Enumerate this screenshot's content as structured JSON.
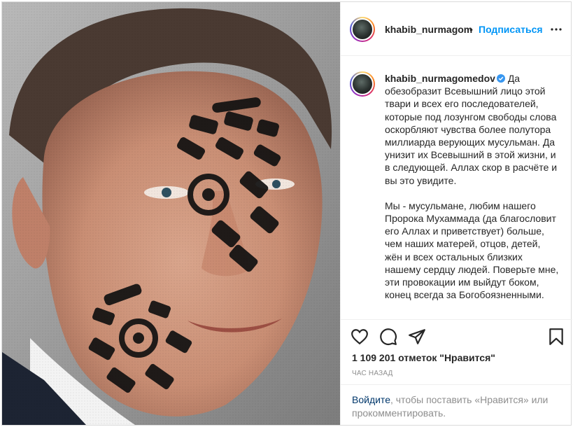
{
  "post": {
    "author": "khabib_nurmagom",
    "author_full": "khabib_nurmagomedov",
    "separator": "•",
    "follow_label": "Подписаться",
    "caption_p1": "Да обезобразит Всевышний лицо этой твари и всех его последователей, которые под лозунгом свободы слова оскорбляют чувства более полутора миллиарда верующих мусульман. Да унизит их Всевышний в этой жизни, и в следующей. Аллах скор в расчёте и вы это увидите.",
    "caption_p2": "Мы - мусульмане, любим нашего Пророка Мухаммада (да благословит его Аллах и приветствует) больше, чем наших матерей, отцов, детей, жён и всех остальных близких нашему сердцу людей. Поверьте мне, эти провокации им выйдут боком, конец всегда за Богобоязненными.",
    "likes": "1 109 201 отметок \"Нравится\"",
    "time": "ЧАС НАЗАД",
    "login_link": "Войдите",
    "login_rest": ", чтобы поставить «Нравится» или прокомментировать."
  },
  "icons": {
    "more": "more-options-icon",
    "verified": "verified-badge-icon",
    "like": "heart-icon",
    "comment": "comment-icon",
    "share": "share-icon",
    "save": "bookmark-icon"
  },
  "colors": {
    "link_blue": "#0095f6",
    "verified_blue": "#3897f0",
    "muted": "#8e8e8e",
    "text": "#262626"
  }
}
